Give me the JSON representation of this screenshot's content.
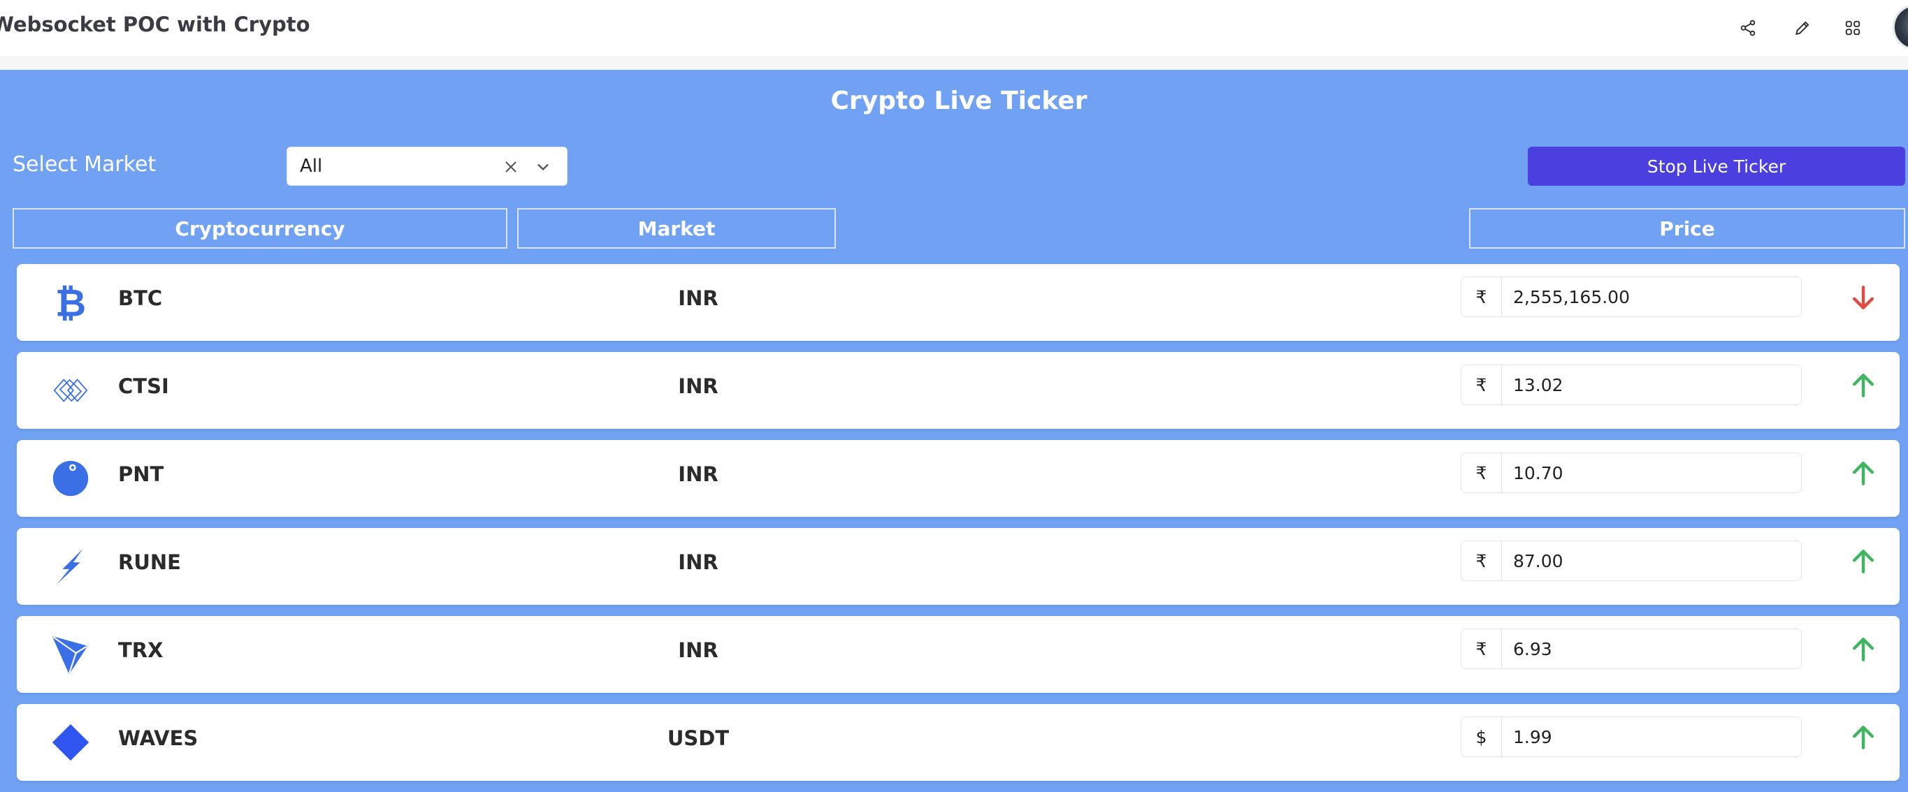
{
  "app": {
    "title": "Websocket POC with Crypto"
  },
  "toolbar": {
    "icons": [
      "share-icon",
      "edit-icon",
      "apps-grid-icon"
    ]
  },
  "ticker": {
    "heading": "Crypto Live Ticker",
    "select_label": "Select Market",
    "select_value": "All",
    "stop_button_label": "Stop Live Ticker"
  },
  "columns": {
    "cryptocurrency": "Cryptocurrency",
    "market": "Market",
    "price": "Price"
  },
  "rows": [
    {
      "symbol": "BTC",
      "market": "INR",
      "currency": "₹",
      "price": "2,555,165.00",
      "trend": "down",
      "icon": "bitcoin-icon"
    },
    {
      "symbol": "CTSI",
      "market": "INR",
      "currency": "₹",
      "price": "13.02",
      "trend": "up",
      "icon": "cartesi-icon"
    },
    {
      "symbol": "PNT",
      "market": "INR",
      "currency": "₹",
      "price": "10.70",
      "trend": "up",
      "icon": "pnetwork-icon"
    },
    {
      "symbol": "RUNE",
      "market": "INR",
      "currency": "₹",
      "price": "87.00",
      "trend": "up",
      "icon": "thorchain-icon"
    },
    {
      "symbol": "TRX",
      "market": "INR",
      "currency": "₹",
      "price": "6.93",
      "trend": "up",
      "icon": "tron-icon"
    },
    {
      "symbol": "WAVES",
      "market": "USDT",
      "currency": "$",
      "price": "1.99",
      "trend": "up",
      "icon": "waves-icon"
    }
  ],
  "colors": {
    "panel_bg": "#70a1f2",
    "button_bg": "#4b3fe0",
    "coin_icon": "#3b6fe6",
    "trend_up": "#3fb55f",
    "trend_down": "#e04a3f"
  }
}
